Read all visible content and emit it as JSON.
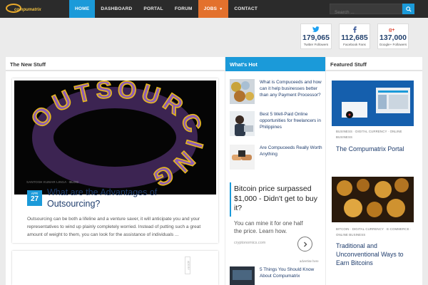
{
  "logo": {
    "text": "compumatrix"
  },
  "nav": {
    "items": [
      {
        "label": "HOME",
        "state": "active"
      },
      {
        "label": "DASHBOARD",
        "state": ""
      },
      {
        "label": "PORTAL",
        "state": ""
      },
      {
        "label": "FORUM",
        "state": ""
      },
      {
        "label": "JOBS",
        "state": "jobs",
        "has_dropdown": true
      },
      {
        "label": "CONTACT",
        "state": ""
      }
    ]
  },
  "search": {
    "placeholder": "Search ...",
    "icon": "search-icon"
  },
  "social": [
    {
      "count": "179,065",
      "label": "Twitter Followers",
      "icon": "twitter-icon"
    },
    {
      "count": "112,685",
      "label": "Facebook Fans",
      "icon": "facebook-icon"
    },
    {
      "count": "137,000",
      "label": "Google+ Followers",
      "icon": "google-plus-icon"
    }
  ],
  "columns": {
    "new_stuff": "The New Stuff",
    "whats_hot": "What's Hot",
    "featured": "Featured Stuff"
  },
  "main_post": {
    "image_text": "OUTSOURCING",
    "author": "SANTOSH KUMAR LINGA",
    "category": "BLOG",
    "date_month": "APR",
    "date_day": "27",
    "title": "What are the Advantages of Outsourcing?",
    "excerpt": "Outsourcing can be both a lifeline and a venture saver, it will anticipate you and your representatives to wind up plainly completely worried. Instead of putting such a great amount of weight to them, you can look for the assistance of individuals ..."
  },
  "second_card": {
    "ad_label": "ADS BY"
  },
  "hot_items": [
    {
      "title": "What is Compuceeds and how can it help businesses better than any Payment Processor?"
    },
    {
      "title": "Best 5 Well-Paid Online opportunities for freelancers in Philippines"
    },
    {
      "title": "Are Compuceeds Really Worth Anything"
    },
    {
      "title": "5 Things You Should Know About Compumatrix"
    }
  ],
  "ad": {
    "title": "Bitcoin price surpassed $1,000 - Didn't get to buy it?",
    "body": "You can mine it for one half the price. Learn how.",
    "url": "cryptonomics.com",
    "note": "advertise here"
  },
  "featured": [
    {
      "categories": "BUSINESS · DIGITAL CURRENCY · ONLINE BUSINESS",
      "title": "The Compumatrix Portal"
    },
    {
      "categories": "BITCOIN · DIGITAL CURRENCY · E-COMMERCE · ONLINE BUSINESS",
      "title": "Traditional and Unconventional Ways to Earn Bitcoins"
    }
  ],
  "colors": {
    "nav_bg": "#2b2b2b",
    "accent": "#1b9ad9",
    "jobs": "#e3712d",
    "title_blue": "#1f3d6d"
  }
}
